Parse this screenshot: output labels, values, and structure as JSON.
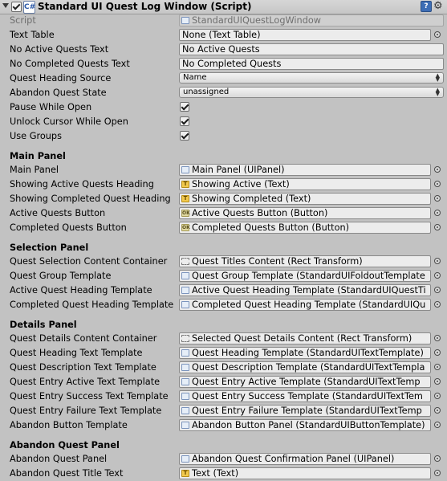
{
  "header": {
    "title": "Standard UI Quest Log Window (Script)",
    "script_icon": "C#"
  },
  "fields": {
    "script": {
      "label": "Script",
      "value": "StandardUIQuestLogWindow"
    },
    "text_table": {
      "label": "Text Table",
      "value": "None (Text Table)"
    },
    "no_active": {
      "label": "No Active Quests Text",
      "value": "No Active Quests"
    },
    "no_completed": {
      "label": "No Completed Quests Text",
      "value": "No Completed Quests"
    },
    "heading_source": {
      "label": "Quest Heading Source",
      "value": "Name"
    },
    "abandon_state": {
      "label": "Abandon Quest State",
      "value": "unassigned"
    },
    "pause": {
      "label": "Pause While Open",
      "checked": true
    },
    "unlock": {
      "label": "Unlock Cursor While Open",
      "checked": true
    },
    "groups": {
      "label": "Use Groups",
      "checked": true
    }
  },
  "main_panel": {
    "title": "Main Panel",
    "rows": [
      {
        "label": "Main Panel",
        "value": "Main Panel (UIPanel)",
        "icon": "script"
      },
      {
        "label": "Showing Active Quests Heading",
        "value": "Showing Active (Text)",
        "icon": "text"
      },
      {
        "label": "Showing Completed Quest Heading",
        "value": "Showing Completed (Text)",
        "icon": "text"
      },
      {
        "label": "Active Quests Button",
        "value": "Active Quests Button (Button)",
        "icon": "ok"
      },
      {
        "label": "Completed Quests Button",
        "value": "Completed Quests Button (Button)",
        "icon": "ok"
      }
    ]
  },
  "selection_panel": {
    "title": "Selection Panel",
    "rows": [
      {
        "label": "Quest Selection Content Container",
        "value": "Quest Titles Content (Rect Transform)",
        "icon": "rect"
      },
      {
        "label": "Quest Group Template",
        "value": "Quest Group Template (StandardUIFoldoutTemplate",
        "icon": "script"
      },
      {
        "label": "Active Quest Heading Template",
        "value": "Active Quest Heading Template (StandardUIQuestTi",
        "icon": "script"
      },
      {
        "label": "Completed Quest Heading Template",
        "value": "Completed Quest Heading Template (StandardUIQu",
        "icon": "script"
      }
    ]
  },
  "details_panel": {
    "title": "Details Panel",
    "rows": [
      {
        "label": "Quest Details Content Container",
        "value": "Selected Quest Details Content (Rect Transform)",
        "icon": "rect"
      },
      {
        "label": "Quest Heading Text Template",
        "value": "Quest Heading Template (StandardUITextTemplate)",
        "icon": "script"
      },
      {
        "label": "Quest Description Text Template",
        "value": "Quest Description Template (StandardUITextTempla",
        "icon": "script"
      },
      {
        "label": "Quest Entry Active Text Template",
        "value": "Quest Entry Active Template (StandardUITextTemp",
        "icon": "script"
      },
      {
        "label": "Quest Entry Success Text Template",
        "value": "Quest Entry Success Template (StandardUITextTem",
        "icon": "script"
      },
      {
        "label": "Quest Entry Failure Text Template",
        "value": "Quest Entry Failure Template (StandardUITextTemp",
        "icon": "script"
      },
      {
        "label": "Abandon Button Template",
        "value": "Abandon Button Panel (StandardUIButtonTemplate)",
        "icon": "script"
      }
    ]
  },
  "abandon_panel": {
    "title": "Abandon Quest Panel",
    "rows": [
      {
        "label": "Abandon Quest Panel",
        "value": "Abandon Quest Confirmation Panel (UIPanel)",
        "icon": "script"
      },
      {
        "label": "Abandon Quest Title Text",
        "value": "Text (Text)",
        "icon": "text"
      }
    ]
  },
  "colors": {
    "inspector_bg": "#c2c2c2",
    "field_bg": "#ececec",
    "help_icon": "#3d6db5"
  }
}
